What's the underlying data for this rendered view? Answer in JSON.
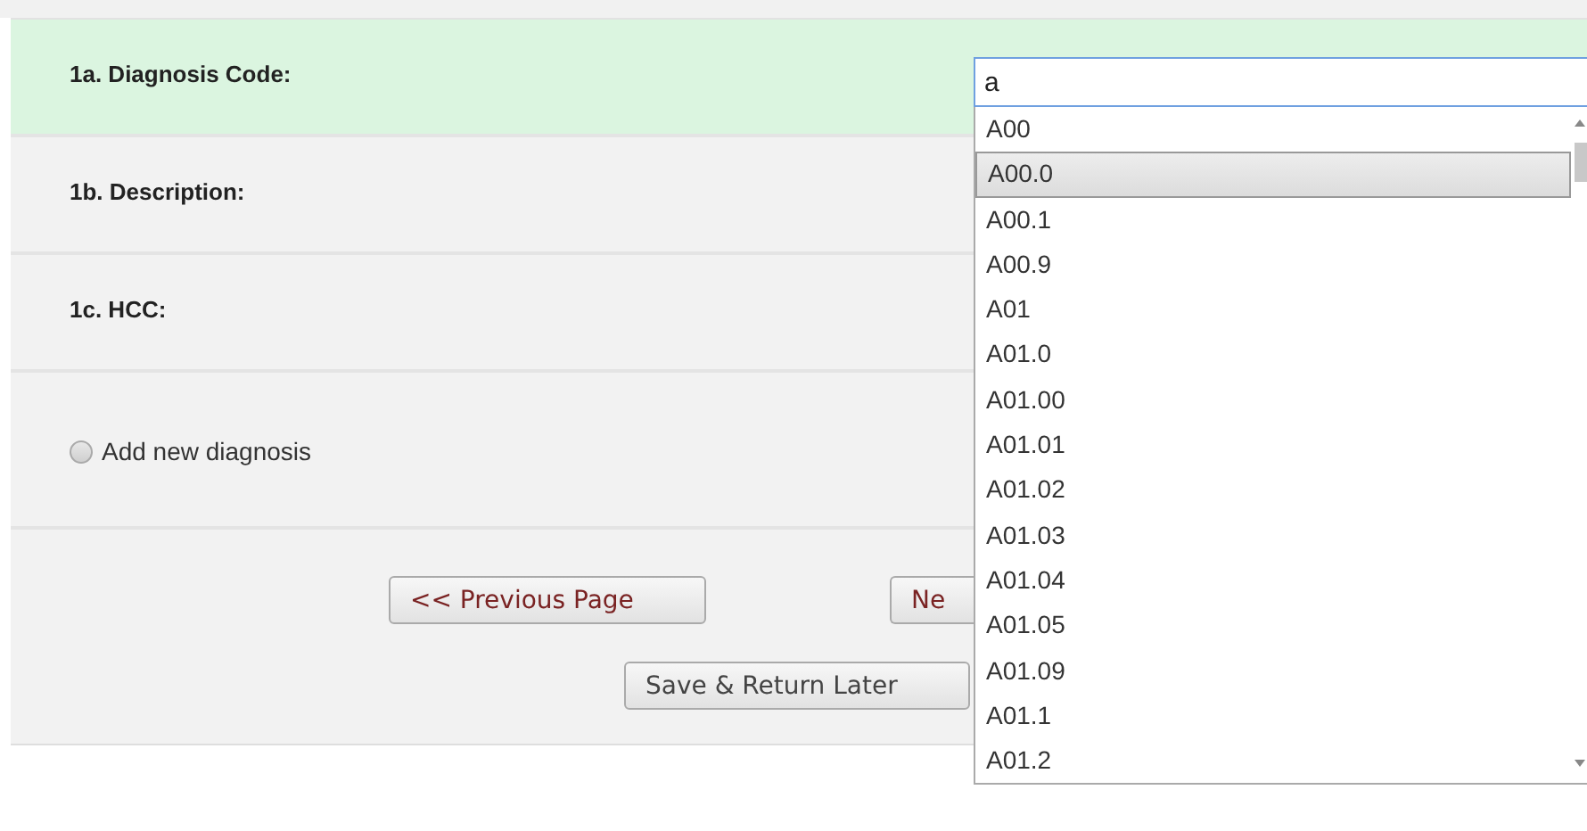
{
  "fields": [
    {
      "label": "1a. Diagnosis Code:",
      "highlighted": true
    },
    {
      "label": "1b. Description:",
      "highlighted": false
    },
    {
      "label": "1c. HCC:",
      "highlighted": false
    }
  ],
  "add_new": {
    "label": "Add new diagnosis",
    "checked": false
  },
  "buttons": {
    "previous": "<< Previous Page",
    "next": "Ne",
    "save": "Save & Return Later"
  },
  "autocomplete": {
    "value": "a",
    "options": [
      {
        "label": "A00",
        "selected": false
      },
      {
        "label": "A00.0",
        "selected": true
      },
      {
        "label": "A00.1",
        "selected": false
      },
      {
        "label": "A00.9",
        "selected": false
      },
      {
        "label": "A01",
        "selected": false
      },
      {
        "label": "A01.0",
        "selected": false
      },
      {
        "label": "A01.00",
        "selected": false
      },
      {
        "label": "A01.01",
        "selected": false
      },
      {
        "label": "A01.02",
        "selected": false
      },
      {
        "label": "A01.03",
        "selected": false
      },
      {
        "label": "A01.04",
        "selected": false
      },
      {
        "label": "A01.05",
        "selected": false
      },
      {
        "label": "A01.09",
        "selected": false
      },
      {
        "label": "A01.1",
        "selected": false
      },
      {
        "label": "A01.2",
        "selected": false
      }
    ]
  }
}
